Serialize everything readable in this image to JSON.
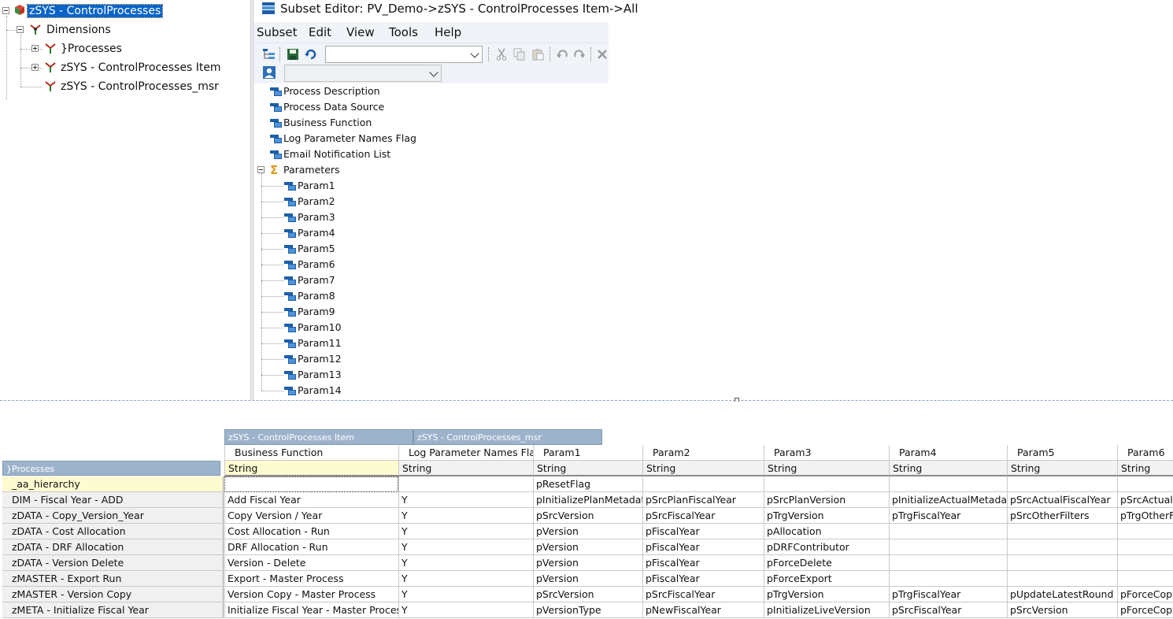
{
  "tree": {
    "root": "zSYS - ControlProcesses",
    "dimensions_label": "Dimensions",
    "children": [
      "}Processes",
      "zSYS - ControlProcesses Item",
      "zSYS - ControlProcesses_msr"
    ]
  },
  "subset_editor": {
    "title": "Subset Editor:  PV_Demo->zSYS - ControlProcesses Item->All",
    "menu": [
      "Subset",
      "Edit",
      "View",
      "Tools",
      "Help"
    ],
    "combo1_value": "",
    "combo2_value": "",
    "items": [
      "Process Description",
      "Process Data Source",
      "Business Function",
      "Log Parameter Names Flag",
      "Email Notification List",
      "Parameters"
    ],
    "param_children": [
      "Param1",
      "Param2",
      "Param3",
      "Param4",
      "Param5",
      "Param6",
      "Param7",
      "Param8",
      "Param9",
      "Param10",
      "Param11",
      "Param12",
      "Param13",
      "Param14"
    ]
  },
  "grid": {
    "column_dims": [
      "zSYS - ControlProcesses Item",
      "zSYS - ControlProcesses_msr"
    ],
    "row_dim": "}Processes",
    "columns": [
      {
        "name": "Business Function",
        "type": "String"
      },
      {
        "name": "Log Parameter Names Flag",
        "type": "String"
      },
      {
        "name": "Param1",
        "type": "String"
      },
      {
        "name": "Param2",
        "type": "String"
      },
      {
        "name": "Param3",
        "type": "String"
      },
      {
        "name": "Param4",
        "type": "String"
      },
      {
        "name": "Param5",
        "type": "String"
      },
      {
        "name": "Param6",
        "type": "String"
      }
    ],
    "rows": [
      {
        "name": "_aa_hierarchy",
        "cells": [
          "",
          "",
          "pResetFlag",
          "",
          "",
          "",
          "",
          ""
        ]
      },
      {
        "name": "DIM - Fiscal Year - ADD",
        "cells": [
          "Add Fiscal Year",
          "Y",
          "pInitializePlanMetadata",
          "pSrcPlanFiscalYear",
          "pSrcPlanVersion",
          "pInitializeActualMetadata",
          "pSrcActualFiscalYear",
          "pSrcActualV"
        ]
      },
      {
        "name": "zDATA - Copy_Version_Year",
        "cells": [
          "Copy Version / Year",
          "Y",
          "pSrcVersion",
          "pSrcFiscalYear",
          "pTrgVersion",
          "pTrgFiscalYear",
          "pSrcOtherFilters",
          "pTrgOtherF"
        ]
      },
      {
        "name": "zDATA - Cost Allocation",
        "cells": [
          "Cost Allocation - Run",
          "Y",
          "pVersion",
          "pFiscalYear",
          "pAllocation",
          "",
          "",
          ""
        ]
      },
      {
        "name": "zDATA - DRF Allocation",
        "cells": [
          "DRF Allocation - Run",
          "Y",
          "pVersion",
          "pFiscalYear",
          "pDRFContributor",
          "",
          "",
          ""
        ]
      },
      {
        "name": "zDATA - Version Delete",
        "cells": [
          "Version - Delete",
          "Y",
          "pVersion",
          "pFiscalYear",
          "pForceDelete",
          "",
          "",
          ""
        ]
      },
      {
        "name": "zMASTER - Export Run",
        "cells": [
          "Export - Master Process",
          "Y",
          "pVersion",
          "pFiscalYear",
          "pForceExport",
          "",
          "",
          ""
        ]
      },
      {
        "name": "zMASTER - Version Copy",
        "cells": [
          "Version Copy - Master Process",
          "Y",
          "pSrcVersion",
          "pSrcFiscalYear",
          "pTrgVersion",
          "pTrgFiscalYear",
          "pUpdateLatestRound",
          "pForceCopy"
        ]
      },
      {
        "name": "zMETA - Initialize Fiscal Year",
        "cells": [
          "Initialize Fiscal Year - Master Process",
          "Y",
          "pVersionType",
          "pNewFiscalYear",
          "pInitializeLiveVersion",
          "pSrcFiscalYear",
          "pSrcVersion",
          "pForceCopy"
        ]
      }
    ]
  },
  "colors": {
    "selection": "#0a64c8",
    "dim_tab": "#9db3cc",
    "highlight": "#fdfbd0",
    "toolbar_bg": "#f0f4f9"
  }
}
